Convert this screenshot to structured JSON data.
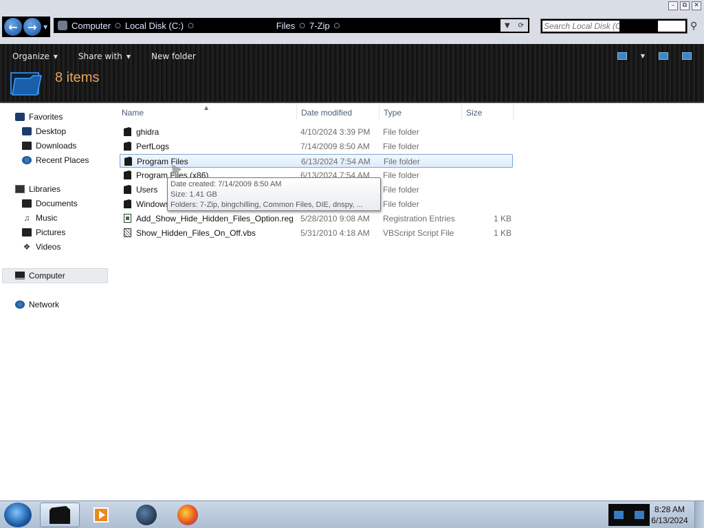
{
  "window": {
    "controls": [
      "–",
      "⧉",
      "✕"
    ]
  },
  "address": {
    "crumbs": [
      "Computer",
      "Local Disk (C:)",
      "Files",
      "7-Zip"
    ]
  },
  "search": {
    "placeholder": "Search Local Disk (C:)"
  },
  "toolbar": {
    "organize": "Organize",
    "share_with": "Share with",
    "new_folder": "New folder",
    "item_count": "8 items"
  },
  "sidebar": {
    "favorites": "Favorites",
    "desktop": "Desktop",
    "downloads": "Downloads",
    "recent_places": "Recent Places",
    "libraries": "Libraries",
    "documents": "Documents",
    "music": "Music",
    "pictures": "Pictures",
    "videos": "Videos",
    "computer": "Computer",
    "network": "Network"
  },
  "columns": {
    "name": "Name",
    "date": "Date modified",
    "type": "Type",
    "size": "Size"
  },
  "files": [
    {
      "name": "ghidra",
      "date": "4/10/2024 3:39 PM",
      "type": "File folder",
      "size": "",
      "icon": "folder-icon"
    },
    {
      "name": "PerfLogs",
      "date": "7/14/2009 8:50 AM",
      "type": "File folder",
      "size": "",
      "icon": "folder-icon"
    },
    {
      "name": "Program Files",
      "date": "6/13/2024 7:54 AM",
      "type": "File folder",
      "size": "",
      "icon": "folder-icon"
    },
    {
      "name": "Program Files (x86)",
      "date": "6/13/2024 7:54 AM",
      "type": "File folder",
      "size": "",
      "icon": "folder-icon"
    },
    {
      "name": "Users",
      "date": "",
      "type": "File folder",
      "size": "",
      "icon": "folder-icon"
    },
    {
      "name": "Windows",
      "date": "",
      "type": "File folder",
      "size": "",
      "icon": "folder-icon"
    },
    {
      "name": "Add_Show_Hide_Hidden_Files_Option.reg",
      "date": "5/28/2010 9:08 AM",
      "type": "Registration Entries",
      "size": "1 KB",
      "icon": "registry-file-icon"
    },
    {
      "name": "Show_Hidden_Files_On_Off.vbs",
      "date": "5/31/2010 4:18 AM",
      "type": "VBScript Script File",
      "size": "1 KB",
      "icon": "script-file-icon"
    }
  ],
  "tooltip": {
    "created": "Date created: 7/14/2009 8:50 AM",
    "size": "Size: 1.41 GB",
    "folders": "Folders: 7-Zip, bingchilling, Common Files, DIE, dnspy, ..."
  },
  "taskbar": {
    "time": "8:28 AM",
    "date": "6/13/2024"
  },
  "colors": {
    "accent_count": "#e8a45e",
    "selection_border": "#7da2ce"
  }
}
